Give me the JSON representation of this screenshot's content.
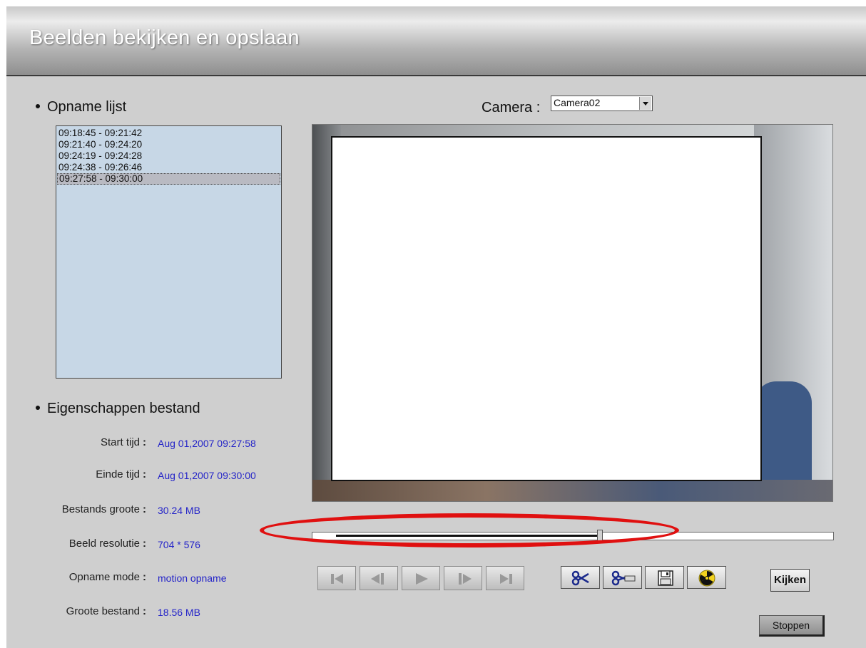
{
  "header": {
    "title": "Beelden bekijken en opslaan"
  },
  "recordings": {
    "title": "Opname lijst",
    "items": [
      "09:18:45 - 09:21:42",
      "09:21:40 - 09:24:20",
      "09:24:19 - 09:24:28",
      "09:24:38 - 09:26:46",
      "09:27:58 - 09:30:00"
    ],
    "selected_item": "09:27:58 - 09:30:00"
  },
  "properties": {
    "title": "Eigenschappen bestand",
    "start_label": "Start tijd",
    "start_value": "Aug 01,2007 09:27:58",
    "end_label": "Einde tijd",
    "end_value": "Aug 01,2007 09:30:00",
    "filesize_label": "Bestands groote",
    "filesize_value": "30.24 MB",
    "resolution_label": "Beeld resolutie",
    "resolution_value": "704 * 576",
    "mode_label": "Opname mode",
    "mode_value": "motion opname",
    "size_label": "Groote bestand",
    "size_value": "18.56 MB"
  },
  "camera": {
    "label": "Camera :",
    "selected": "Camera02"
  },
  "playback": {
    "seek_progress": 0.55
  },
  "controls": {
    "icons": [
      "skip-to-start-icon",
      "step-back-icon",
      "play-icon",
      "step-forward-icon",
      "skip-to-end-icon"
    ]
  },
  "tools": {
    "icons": [
      "scissors-icon",
      "cut-clip-icon",
      "floppy-disk-icon",
      "radiation-icon"
    ]
  },
  "buttons": {
    "watch": "Kijken",
    "stop": "Stoppen"
  },
  "colors": {
    "value_text": "#2424c8",
    "list_background": "#c7d7e6",
    "highlight": "#e01010",
    "background": "#cfcfcf"
  }
}
